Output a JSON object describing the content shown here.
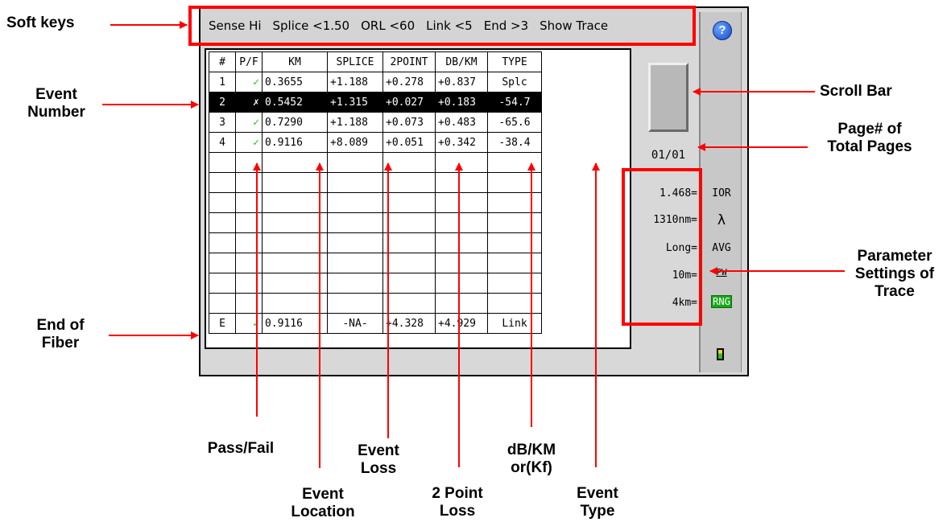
{
  "soft_keys": [
    "Sense Hi",
    "Splice <1.50",
    "ORL <60",
    "Link <5",
    "End >3",
    "Show Trace"
  ],
  "help_icon": "?",
  "table": {
    "headers": [
      "#",
      "P/F",
      "KM",
      "SPLICE",
      "2POINT",
      "DB/KM",
      "TYPE"
    ],
    "rows": [
      {
        "num": "1",
        "pf": "✓",
        "pf_status": "pass",
        "km": "0.3655",
        "splice": "+1.188",
        "two_point": "+0.278",
        "db_km": "+0.837",
        "type": "Splc",
        "selected": false
      },
      {
        "num": "2",
        "pf": "✗",
        "pf_status": "fail",
        "km": "0.5452",
        "splice": "+1.315",
        "two_point": "+0.027",
        "db_km": "+0.183",
        "type": "-54.7",
        "selected": true
      },
      {
        "num": "3",
        "pf": "✓",
        "pf_status": "pass",
        "km": "0.7290",
        "splice": "+1.188",
        "two_point": "+0.073",
        "db_km": "+0.483",
        "type": "-65.6",
        "selected": false
      },
      {
        "num": "4",
        "pf": "✓",
        "pf_status": "pass",
        "km": "0.9116",
        "splice": "+8.089",
        "two_point": "+0.051",
        "db_km": "+0.342",
        "type": "-38.4",
        "selected": false
      }
    ],
    "end_row": {
      "num": "E",
      "pf": "✓",
      "km": "0.9116",
      "splice": "-NA-",
      "two_point": "+4.328",
      "db_km": "+4.929",
      "type": "Link"
    }
  },
  "page_number": "01/01",
  "parameters": [
    {
      "value": "1.468=",
      "icon": "IOR"
    },
    {
      "value": "1310nm=",
      "icon": "λ"
    },
    {
      "value": "Long=",
      "icon": "AVG"
    },
    {
      "value": "10m=",
      "icon": "PW"
    },
    {
      "value": "4km=",
      "icon": "RNG"
    }
  ],
  "annotations": {
    "soft_keys": "Soft keys",
    "event_number": "Event Number",
    "scroll_bar": "Scroll Bar",
    "page_total": "Page# of Total Pages",
    "parameter_settings": "Parameter Settings of Trace",
    "end_of_fiber": "End of Fiber",
    "pass_fail": "Pass/Fail",
    "event_location": "Event Location",
    "event_loss": "Event Loss",
    "two_point_loss": "2 Point Loss",
    "db_km": "dB/KM or(Kf)",
    "event_type": "Event Type"
  },
  "colors": {
    "annotation": "#ff0000",
    "pass": "#19c419",
    "fail": "#ff2020",
    "selected_row": "#000000",
    "rng_badge": "#18a818"
  }
}
